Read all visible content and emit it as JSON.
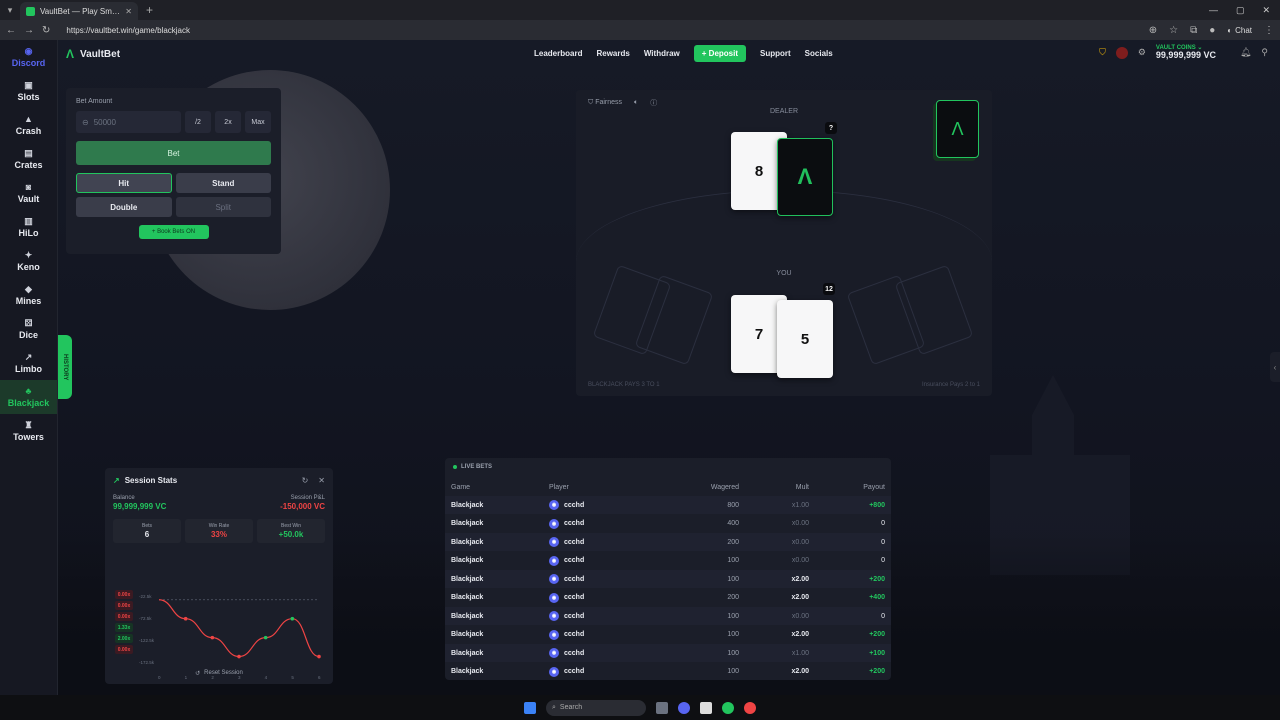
{
  "browser": {
    "tab_title": "VaultBet — Play Smarter, Bet",
    "url": "https://vaultbet.win/game/blackjack",
    "chat_label": "Chat"
  },
  "brand": {
    "name": "VaultBet"
  },
  "sidenav": [
    {
      "label": "Discord",
      "icon": "discord-icon"
    },
    {
      "label": "Slots",
      "icon": "slots-icon"
    },
    {
      "label": "Crash",
      "icon": "crash-icon"
    },
    {
      "label": "Crates",
      "icon": "crates-icon"
    },
    {
      "label": "Vault",
      "icon": "vault-icon"
    },
    {
      "label": "HiLo",
      "icon": "hilo-icon"
    },
    {
      "label": "Keno",
      "icon": "keno-icon"
    },
    {
      "label": "Mines",
      "icon": "mines-icon"
    },
    {
      "label": "Dice",
      "icon": "dice-icon"
    },
    {
      "label": "Limbo",
      "icon": "limbo-icon"
    },
    {
      "label": "Blackjack",
      "icon": "blackjack-icon",
      "active": true
    },
    {
      "label": "Towers",
      "icon": "towers-icon"
    }
  ],
  "history_tab": "HISTORY",
  "topnav": {
    "leaderboard": "Leaderboard",
    "rewards": "Rewards",
    "withdraw": "Withdraw",
    "deposit": "+ Deposit",
    "support": "Support",
    "socials": "Socials"
  },
  "wallet": {
    "label": "VAULT COINS ⌄",
    "value": "99,999,999 VC"
  },
  "bet_panel": {
    "amount_label": "Bet Amount",
    "amount_placeholder": "50000",
    "half": "/2",
    "double_amt": "2x",
    "max": "Max",
    "bet": "Bet",
    "hit": "Hit",
    "stand": "Stand",
    "double": "Double",
    "split": "Split",
    "book_bets": "+ Book Bets ON"
  },
  "table": {
    "fairness": "Fairness",
    "dealer_label": "DEALER",
    "you_label": "YOU",
    "dealer_score": "?",
    "player_score": "12",
    "dealer_cards": [
      "8"
    ],
    "player_cards": [
      "7",
      "5"
    ],
    "footer_left": "BLACKJACK PAYS 3 TO 1",
    "footer_right": "Insurance Pays 2 to 1"
  },
  "session": {
    "title": "Session Stats",
    "balance_label": "Balance",
    "balance_value": "99,999,999 VC",
    "pnl_label": "Session P&L",
    "pnl_value": "-150,000 VC",
    "bets_label": "Bets",
    "bets_value": "6",
    "winrate_label": "Win Rate",
    "winrate_value": "33%",
    "bestwin_label": "Best Win",
    "bestwin_value": "+50.0k",
    "multipliers": [
      {
        "v": "0.00x",
        "win": false
      },
      {
        "v": "0.00x",
        "win": false
      },
      {
        "v": "0.00x",
        "win": false
      },
      {
        "v": "1.33x",
        "win": true
      },
      {
        "v": "2.00x",
        "win": true
      },
      {
        "v": "0.00x",
        "win": false
      }
    ],
    "reset_label": "Reset Session",
    "chart_data": {
      "type": "line",
      "x": [
        0,
        1,
        2,
        3,
        4,
        5,
        6
      ],
      "y_ticks": [
        "-22.5k",
        "-72.5k",
        "-122.5k",
        "-172.5k"
      ],
      "points": [
        {
          "x": 0,
          "y": 0
        },
        {
          "x": 1,
          "y": -50000
        },
        {
          "x": 2,
          "y": -100000
        },
        {
          "x": 3,
          "y": -150000
        },
        {
          "x": 4,
          "y": -100000
        },
        {
          "x": 5,
          "y": -50000
        },
        {
          "x": 6,
          "y": -150000
        }
      ],
      "ylim": [
        -175000,
        10000
      ]
    }
  },
  "live_bets": {
    "title": "LIVE BETS",
    "headers": {
      "game": "Game",
      "player": "Player",
      "wagered": "Wagered",
      "mult": "Mult",
      "payout": "Payout"
    },
    "rows": [
      {
        "game": "Blackjack",
        "player": "ccchd",
        "wagered": "800",
        "mult": "x1.00",
        "payout": "+800",
        "win": true,
        "mwin": false
      },
      {
        "game": "Blackjack",
        "player": "ccchd",
        "wagered": "400",
        "mult": "x0.00",
        "payout": "0",
        "win": false,
        "mwin": false
      },
      {
        "game": "Blackjack",
        "player": "ccchd",
        "wagered": "200",
        "mult": "x0.00",
        "payout": "0",
        "win": false,
        "mwin": false
      },
      {
        "game": "Blackjack",
        "player": "ccchd",
        "wagered": "100",
        "mult": "x0.00",
        "payout": "0",
        "win": false,
        "mwin": false
      },
      {
        "game": "Blackjack",
        "player": "ccchd",
        "wagered": "100",
        "mult": "x2.00",
        "payout": "+200",
        "win": true,
        "mwin": true
      },
      {
        "game": "Blackjack",
        "player": "ccchd",
        "wagered": "200",
        "mult": "x2.00",
        "payout": "+400",
        "win": true,
        "mwin": true
      },
      {
        "game": "Blackjack",
        "player": "ccchd",
        "wagered": "100",
        "mult": "x0.00",
        "payout": "0",
        "win": false,
        "mwin": false
      },
      {
        "game": "Blackjack",
        "player": "ccchd",
        "wagered": "100",
        "mult": "x2.00",
        "payout": "+200",
        "win": true,
        "mwin": true
      },
      {
        "game": "Blackjack",
        "player": "ccchd",
        "wagered": "100",
        "mult": "x1.00",
        "payout": "+100",
        "win": true,
        "mwin": false
      },
      {
        "game": "Blackjack",
        "player": "ccchd",
        "wagered": "100",
        "mult": "x2.00",
        "payout": "+200",
        "win": true,
        "mwin": true
      }
    ]
  },
  "taskbar": {
    "search_placeholder": "Search"
  },
  "colors": {
    "accent": "#22c55e",
    "loss": "#ef4444",
    "discord": "#5865f2"
  }
}
